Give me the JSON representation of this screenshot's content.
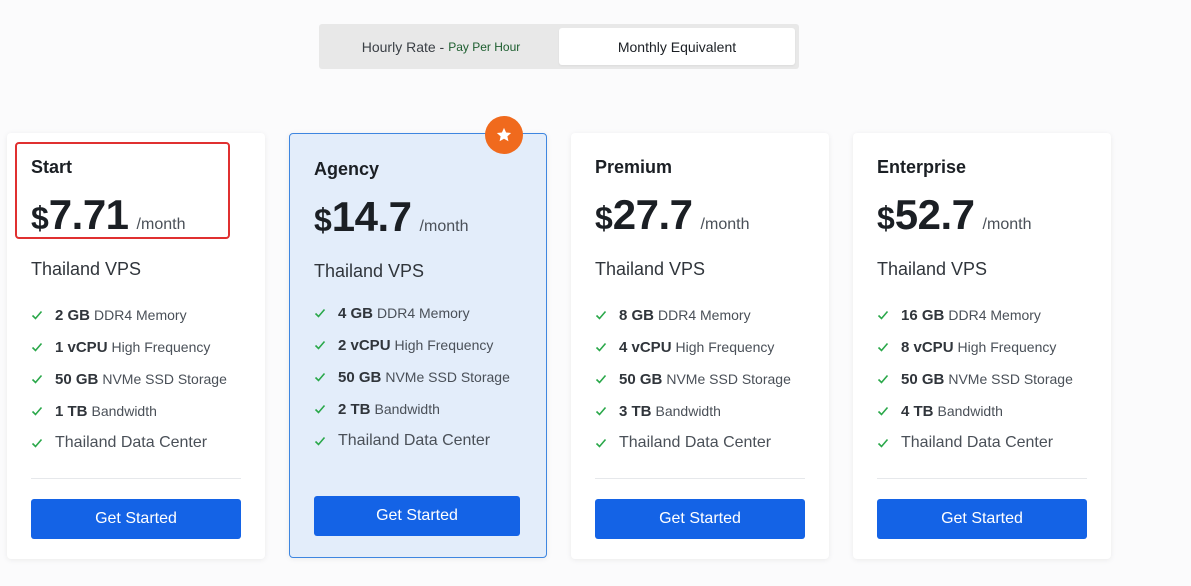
{
  "toggle": {
    "hourly_label": "Hourly Rate -",
    "hourly_sub": "Pay Per Hour",
    "monthly_label": "Monthly Equivalent",
    "active": "monthly"
  },
  "colors": {
    "accent": "#1463e6",
    "featured_bg": "#e3edfa",
    "featured_border": "#3e86e0",
    "badge": "#f06a1d",
    "check": "#2aa84a",
    "highlight": "#e03030"
  },
  "plans": [
    {
      "name": "Start",
      "currency": "$",
      "price": "7.71",
      "period": "/month",
      "product": "Thailand VPS",
      "features": [
        {
          "strong": "2 GB",
          "text": "DDR4 Memory"
        },
        {
          "strong": "1 vCPU",
          "text": "High Frequency"
        },
        {
          "strong": "50 GB",
          "text": "NVMe SSD Storage"
        },
        {
          "strong": "1 TB",
          "text": "Bandwidth"
        },
        {
          "strong": "",
          "text": "Thailand Data Center"
        }
      ],
      "button": "Get Started"
    },
    {
      "name": "Agency",
      "currency": "$",
      "price": "14.7",
      "period": "/month",
      "product": "Thailand VPS",
      "featured_icon": "star-icon",
      "features": [
        {
          "strong": "4 GB",
          "text": "DDR4 Memory"
        },
        {
          "strong": "2 vCPU",
          "text": "High Frequency"
        },
        {
          "strong": "50 GB",
          "text": "NVMe SSD Storage"
        },
        {
          "strong": "2 TB",
          "text": "Bandwidth"
        },
        {
          "strong": "",
          "text": "Thailand Data Center"
        }
      ],
      "button": "Get Started"
    },
    {
      "name": "Premium",
      "currency": "$",
      "price": "27.7",
      "period": "/month",
      "product": "Thailand VPS",
      "features": [
        {
          "strong": "8 GB",
          "text": "DDR4 Memory"
        },
        {
          "strong": "4 vCPU",
          "text": "High Frequency"
        },
        {
          "strong": "50 GB",
          "text": "NVMe SSD Storage"
        },
        {
          "strong": "3 TB",
          "text": "Bandwidth"
        },
        {
          "strong": "",
          "text": "Thailand Data Center"
        }
      ],
      "button": "Get Started"
    },
    {
      "name": "Enterprise",
      "currency": "$",
      "price": "52.7",
      "period": "/month",
      "product": "Thailand VPS",
      "features": [
        {
          "strong": "16 GB",
          "text": "DDR4 Memory"
        },
        {
          "strong": "8 vCPU",
          "text": "High Frequency"
        },
        {
          "strong": "50 GB",
          "text": "NVMe SSD Storage"
        },
        {
          "strong": "4 TB",
          "text": "Bandwidth"
        },
        {
          "strong": "",
          "text": "Thailand Data Center"
        }
      ],
      "button": "Get Started"
    }
  ]
}
